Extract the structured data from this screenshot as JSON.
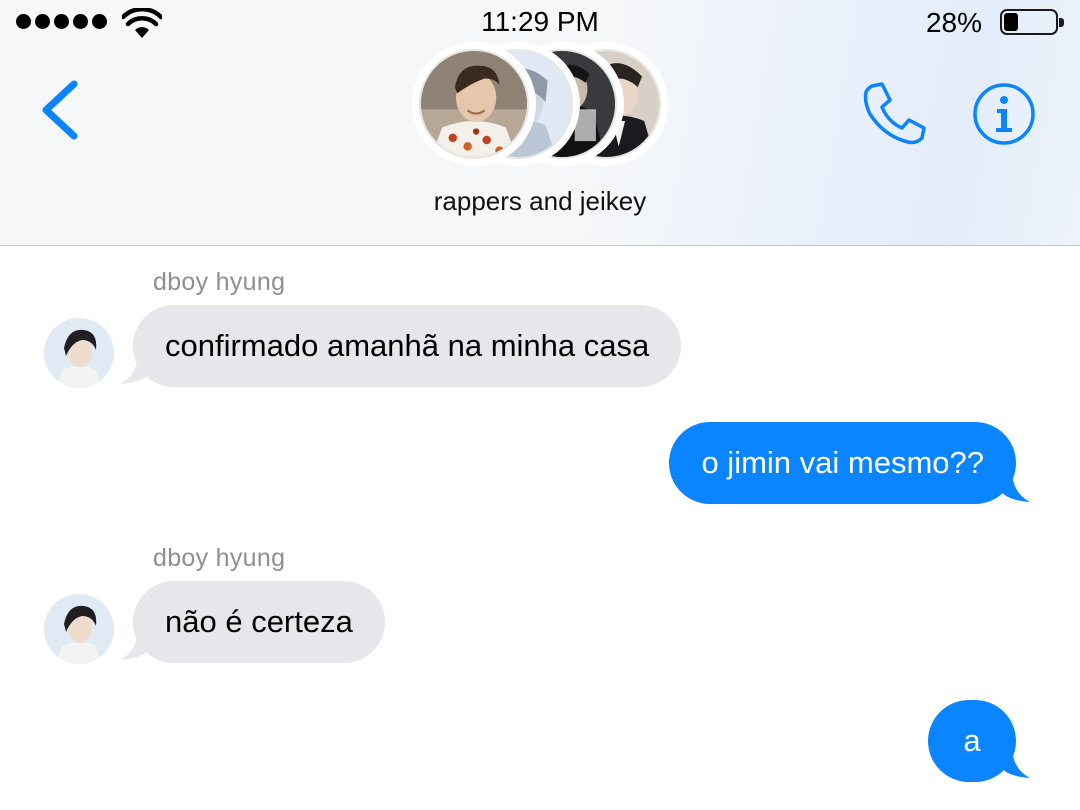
{
  "status_bar": {
    "time": "11:29 PM",
    "battery_percent": "28%",
    "battery_level": 0.28,
    "signal_bars": 5
  },
  "header": {
    "group_name": "rappers and jeikey",
    "back_icon": "chevron-left-icon",
    "call_icon": "phone-icon",
    "info_icon": "info-icon"
  },
  "messages": [
    {
      "direction": "incoming",
      "sender": "dboy hyung",
      "text": "confirmado amanhã na minha casa"
    },
    {
      "direction": "outgoing",
      "text": "o jimin vai mesmo??"
    },
    {
      "direction": "incoming",
      "sender": "dboy hyung",
      "text": "não é certeza"
    },
    {
      "direction": "outgoing",
      "text": "a"
    }
  ],
  "colors": {
    "accent": "#0a84ff",
    "incoming_bubble": "#e6e6eb",
    "sender_label": "#8e8e93"
  }
}
